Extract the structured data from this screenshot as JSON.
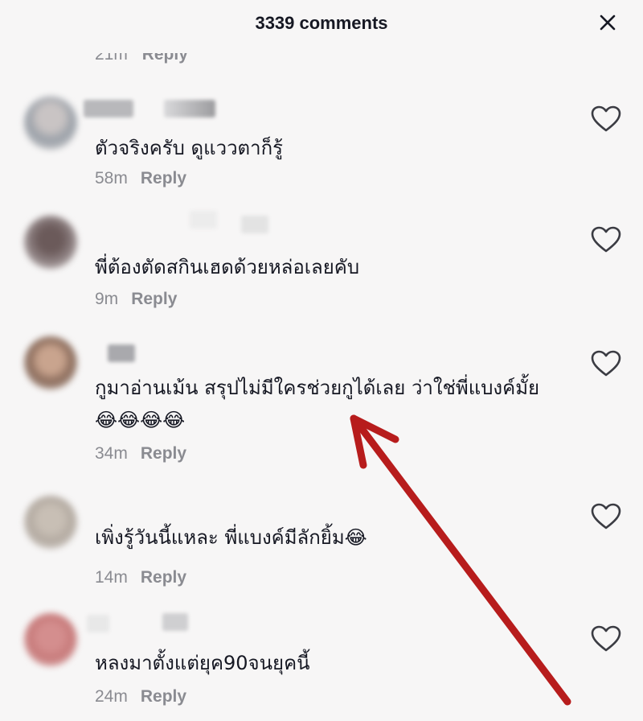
{
  "header": {
    "title": "3339 comments",
    "close_icon": "close-icon"
  },
  "partial_comment": {
    "time": "21m",
    "reply": "Reply"
  },
  "comments": [
    {
      "text": "ตัวจริงครับ ดูแววตาก็รู้",
      "time": "58m",
      "reply": "Reply"
    },
    {
      "text": "พี่ต้องตัดสกินเฮดด้วยหล่อเลยคับ",
      "time": "9m",
      "reply": "Reply"
    },
    {
      "text": "กูมาอ่านเม้น สรุปไม่มีใครช่วยกูได้เลย ว่าใช่พี่แบงค์มั้ย 😂😂😂😂",
      "time": "34m",
      "reply": "Reply"
    },
    {
      "text": "เพิ่งรู้วันนี้แหละ พี่แบงค์มีลักยิ้ม😂",
      "time": "14m",
      "reply": "Reply"
    },
    {
      "text": "หลงมาตั้งแต่ยุค90จนยุคนี้",
      "time": "24m",
      "reply": "Reply"
    }
  ],
  "colors": {
    "background": "#f7f6f6",
    "text": "#161823",
    "muted": "#8a8b91",
    "arrow": "#b71c1c"
  },
  "icons": {
    "like": "heart-outline-icon",
    "annotation": "red-arrow"
  }
}
